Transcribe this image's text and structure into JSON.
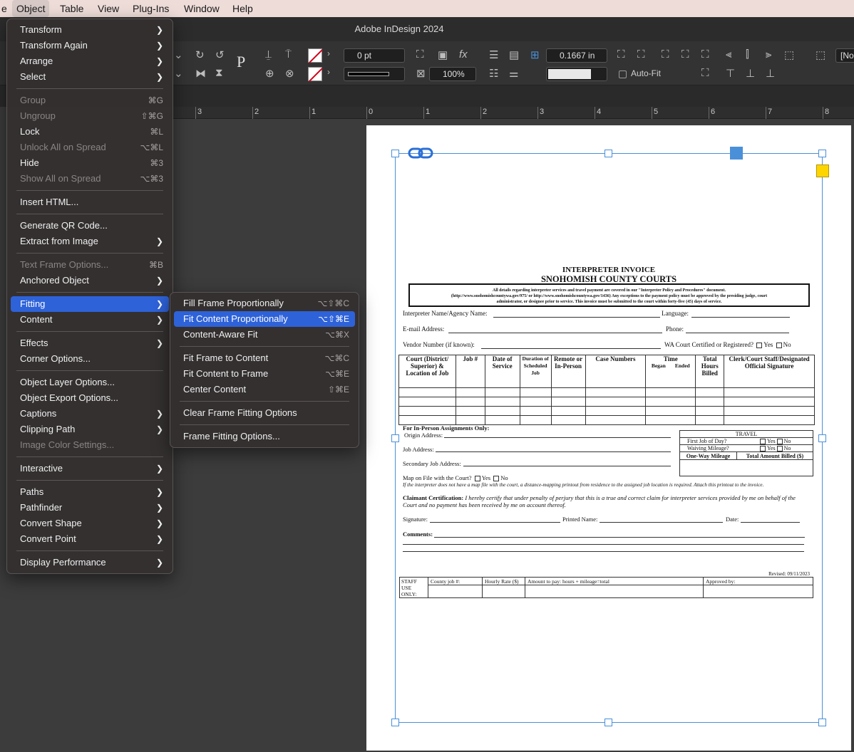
{
  "menubar": {
    "items": [
      "e",
      "Object",
      "Table",
      "View",
      "Plug-Ins",
      "Window",
      "Help"
    ]
  },
  "app": {
    "title": "Adobe InDesign 2024"
  },
  "controlbar": {
    "stroke_weight": "0 pt",
    "scale": "100%",
    "offset": "0.1667 in",
    "autofit_label": "Auto-Fit",
    "style_partial": "[No"
  },
  "ruler": {
    "labels": [
      "3",
      "2",
      "1",
      "0",
      "1",
      "2",
      "3",
      "4",
      "5",
      "6",
      "7",
      "8"
    ]
  },
  "object_menu": {
    "items": [
      {
        "label": "Transform",
        "submenu": true
      },
      {
        "label": "Transform Again",
        "submenu": true
      },
      {
        "label": "Arrange",
        "submenu": true
      },
      {
        "label": "Select",
        "submenu": true
      },
      {
        "sep": true
      },
      {
        "label": "Group",
        "shortcut": "⌘G",
        "disabled": true
      },
      {
        "label": "Ungroup",
        "shortcut": "⇧⌘G",
        "disabled": true
      },
      {
        "label": "Lock",
        "shortcut": "⌘L"
      },
      {
        "label": "Unlock All on Spread",
        "shortcut": "⌥⌘L",
        "disabled": true
      },
      {
        "label": "Hide",
        "shortcut": "⌘3"
      },
      {
        "label": "Show All on Spread",
        "shortcut": "⌥⌘3",
        "disabled": true
      },
      {
        "sep": true
      },
      {
        "label": "Insert HTML..."
      },
      {
        "sep": true
      },
      {
        "label": "Generate QR Code..."
      },
      {
        "label": "Extract from Image",
        "submenu": true
      },
      {
        "sep": true
      },
      {
        "label": "Text Frame Options...",
        "shortcut": "⌘B",
        "disabled": true
      },
      {
        "label": "Anchored Object",
        "submenu": true
      },
      {
        "sep": true
      },
      {
        "label": "Fitting",
        "submenu": true,
        "highlighted": true
      },
      {
        "label": "Content",
        "submenu": true
      },
      {
        "sep": true
      },
      {
        "label": "Effects",
        "submenu": true
      },
      {
        "label": "Corner Options..."
      },
      {
        "sep": true
      },
      {
        "label": "Object Layer Options..."
      },
      {
        "label": "Object Export Options..."
      },
      {
        "label": "Captions",
        "submenu": true
      },
      {
        "label": "Clipping Path",
        "submenu": true
      },
      {
        "label": "Image Color Settings...",
        "disabled": true
      },
      {
        "sep": true
      },
      {
        "label": "Interactive",
        "submenu": true
      },
      {
        "sep": true
      },
      {
        "label": "Paths",
        "submenu": true
      },
      {
        "label": "Pathfinder",
        "submenu": true
      },
      {
        "label": "Convert Shape",
        "submenu": true
      },
      {
        "label": "Convert Point",
        "submenu": true
      },
      {
        "sep": true
      },
      {
        "label": "Display Performance",
        "submenu": true
      }
    ]
  },
  "fitting_menu": {
    "items": [
      {
        "label": "Fill Frame Proportionally",
        "shortcut": "⌥⇧⌘C"
      },
      {
        "label": "Fit Content Proportionally",
        "shortcut": "⌥⇧⌘E",
        "selected": true
      },
      {
        "label": "Content-Aware Fit",
        "shortcut": "⌥⌘X"
      },
      {
        "sep": true
      },
      {
        "label": "Fit Frame to Content",
        "shortcut": "⌥⌘C"
      },
      {
        "label": "Fit Content to Frame",
        "shortcut": "⌥⌘E"
      },
      {
        "label": "Center Content",
        "shortcut": "⇧⌘E"
      },
      {
        "sep": true
      },
      {
        "label": "Clear Frame Fitting Options"
      },
      {
        "sep": true
      },
      {
        "label": "Frame Fitting Options..."
      }
    ]
  },
  "document": {
    "title1": "INTERPRETER INVOICE",
    "title2": "SNOHOMISH COUNTY COURTS",
    "notice_line1": "All details regarding interpreter services and travel payment are covered in our \"Interpreter Policy and Procedures\" document.",
    "notice_line2": "(http://www.snohomishcountywa.gov/975/ or http://www.snohomishcountywa.gov/1436) Any exceptions to the payment policy must be approved by the presiding judge, court",
    "notice_line3": "administrator, or designee prior to service. This invoice must be submitted to the court within forty-five (45) days of service.",
    "field_name": "Interpreter Name/Agency Name:",
    "field_language": "Language:",
    "field_email": "E-mail Address:",
    "field_phone": "Phone:",
    "field_vendor": "Vendor Number (if known):",
    "field_certified": "WA Court Certified or Registered?",
    "yes": "Yes",
    "no": "No",
    "table_headers": [
      "Court (District/ Superior) & Location of Job",
      "Job #",
      "Date of Service",
      "Duration of Scheduled Job",
      "Remote or In-Person",
      "Case Numbers",
      "Time",
      "Total Hours Billed",
      "Clerk/Court Staff/Designated Official Signature"
    ],
    "time_began": "Began",
    "time_ended": "Ended",
    "inperson_title": "For In-Person Assignments Only:",
    "origin": "Origin Address:",
    "job_addr": "Job Address:",
    "secondary": "Secondary Job Address:",
    "travel_title": "TRAVEL",
    "first_job": "First Job of Day?",
    "waiving": "Waiving Mileage?",
    "oneway": "One-Way Mileage",
    "total_billed": "Total Amount Billed ($)",
    "map_on_file": "Map on File with the Court?",
    "map_note": "If the interpreter does not have a map file with the court, a distance-mapping printout from residence to the assigned job location is required. Attach this printout to the invoice.",
    "claimant_label": "Claimant Certification:",
    "claimant_text": "I hereby certify that under penalty of perjury that this is a true and correct claim for interpreter services provided by me on behalf of the Court and no payment has been received by me on account thereof.",
    "signature": "Signature:",
    "printed_name": "Printed Name:",
    "date": "Date:",
    "comments": "Comments:",
    "revised": "Revised: 09/11/2023",
    "staff_use": "STAFF USE ONLY:",
    "county_job": "County job #:",
    "hourly_rate": "Hourly Rate ($)",
    "amount_to_pay": "Amount to pay: hours + mileage=total",
    "approved_by": "Approved by:"
  },
  "colors": {
    "menu_highlight": "#2e62d9",
    "frame": "#4a90d9",
    "corner_handle": "#ffd500"
  }
}
